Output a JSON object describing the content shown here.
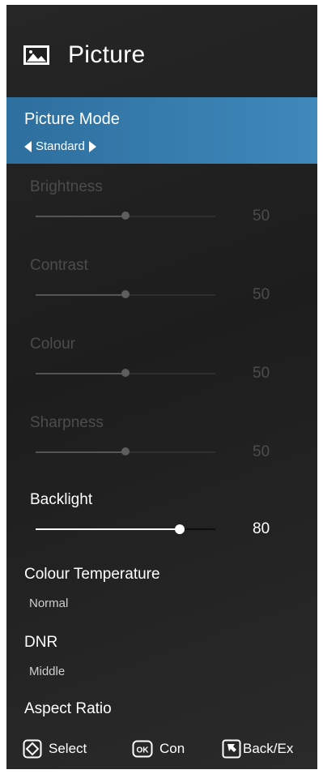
{
  "header": {
    "title": "Picture",
    "icon": "picture-icon"
  },
  "picture_mode": {
    "label": "Picture Mode",
    "value": "Standard"
  },
  "sliders": [
    {
      "label": "Brightness",
      "value": "50",
      "level": 0.5,
      "enabled": false
    },
    {
      "label": "Contrast",
      "value": "50",
      "level": 0.5,
      "enabled": false
    },
    {
      "label": "Colour",
      "value": "50",
      "level": 0.5,
      "enabled": false
    },
    {
      "label": "Sharpness",
      "value": "50",
      "level": 0.5,
      "enabled": false
    },
    {
      "label": "Backlight",
      "value": "80",
      "level": 0.8,
      "enabled": true
    }
  ],
  "colour_temperature": {
    "label": "Colour Temperature",
    "value": "Normal"
  },
  "dnr": {
    "label": "DNR",
    "value": "Middle"
  },
  "aspect_ratio": {
    "label": "Aspect Ratio"
  },
  "footer": {
    "select": {
      "label": "Select",
      "icon": "dpad-icon"
    },
    "confirm": {
      "label": "Con",
      "icon": "ok-icon"
    },
    "back": {
      "label": "Back/Ex",
      "icon": "back-icon"
    }
  },
  "colors": {
    "highlight": "#3a82b3",
    "background": "#222222",
    "disabled_text": "#4c4c4c"
  }
}
